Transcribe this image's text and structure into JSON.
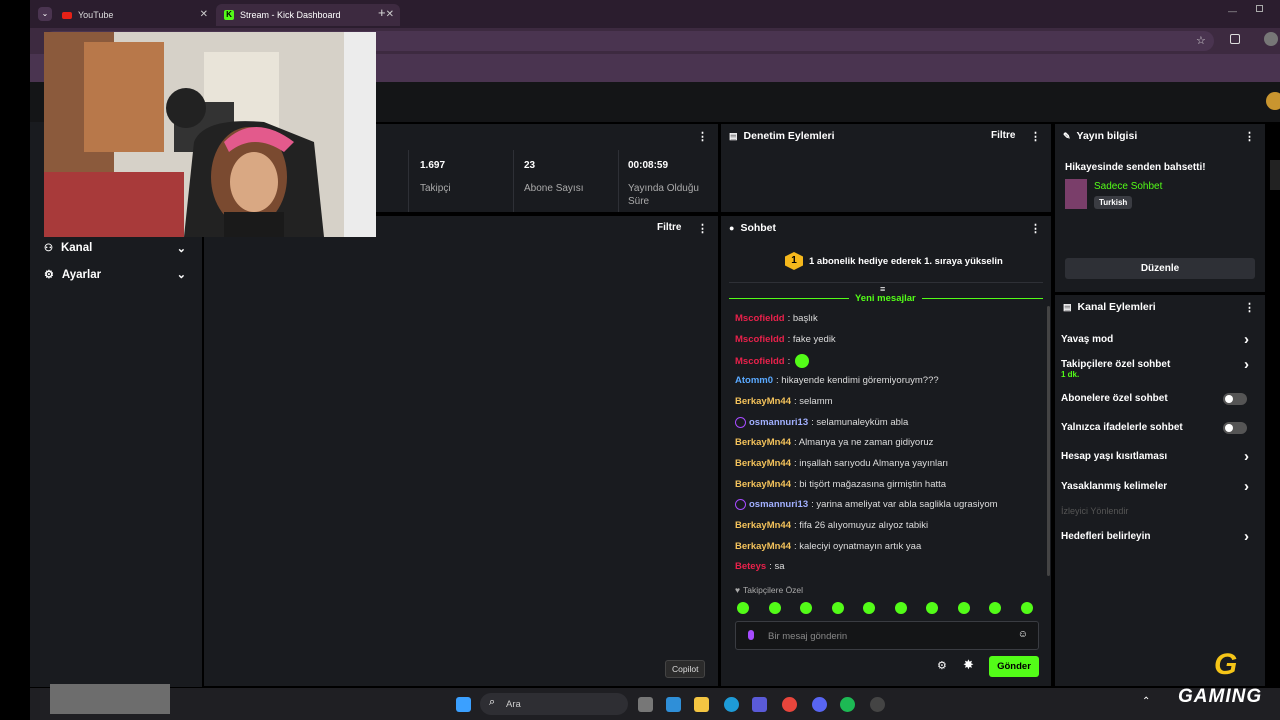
{
  "browser": {
    "tabs": [
      {
        "label": "YouTube"
      },
      {
        "label": "Stream - Kick Dashboard"
      }
    ]
  },
  "left_nav": {
    "items": [
      {
        "label": "Kanal"
      },
      {
        "label": "Ayarlar"
      }
    ]
  },
  "stats": [
    {
      "value": "1.697",
      "label": "Takipçi"
    },
    {
      "value": "23",
      "label": "Abone Sayısı"
    },
    {
      "value": "00:08:59",
      "label": "Yayında Olduğu Süre"
    }
  ],
  "activity_panel": {
    "filter_label": "Filtre"
  },
  "moderation_panel": {
    "title": "Denetim Eylemleri",
    "filter_label": "Filtre"
  },
  "stream_info": {
    "title": "Yayın bilgisi",
    "stream_title": "Hikayesinde senden bahsetti!",
    "category": "Sadece Sohbet",
    "tag": "Turkish",
    "edit_label": "Düzenle"
  },
  "chat": {
    "title": "Sohbet",
    "banner_rank": "1",
    "banner_text": "1 abonelik hediye ederek 1. sıraya yükselin",
    "new_messages_label": "Yeni mesajlar",
    "messages": [
      {
        "user": "Mscofieldd",
        "text": ": başlık",
        "color": "#e8214b",
        "badge": false,
        "emote": false
      },
      {
        "user": "Mscofieldd",
        "text": ": fake yedik",
        "color": "#e8214b",
        "badge": false,
        "emote": false
      },
      {
        "user": "Mscofieldd",
        "text": ":",
        "color": "#e8214b",
        "badge": false,
        "emote": true
      },
      {
        "user": "Atomm0",
        "text": ": hikayende kendimi göremiyoruym???",
        "color": "#5aa9ff",
        "badge": false,
        "emote": false
      },
      {
        "user": "BerkayMn44",
        "text": ": selamm",
        "color": "#f3c25b",
        "badge": false,
        "emote": false
      },
      {
        "user": "osmannuri13",
        "text": ": selamunaleyküm abla",
        "color": "#a2b0ff",
        "badge": true,
        "emote": false
      },
      {
        "user": "BerkayMn44",
        "text": ": Almanya ya ne zaman gidiyoruz",
        "color": "#f3c25b",
        "badge": false,
        "emote": false
      },
      {
        "user": "BerkayMn44",
        "text": ": inşallah sarıyodu Almanya yayınları",
        "color": "#f3c25b",
        "badge": false,
        "emote": false
      },
      {
        "user": "BerkayMn44",
        "text": ": bi tişört mağazasına girmiştin hatta",
        "color": "#f3c25b",
        "badge": false,
        "emote": false
      },
      {
        "user": "osmannuri13",
        "text": ": yarina ameliyat var abla saglikla ugrasiyom",
        "color": "#a2b0ff",
        "badge": true,
        "emote": false
      },
      {
        "user": "BerkayMn44",
        "text": ": fifa 26 alıyomuyuz alıyoz tabiki",
        "color": "#f3c25b",
        "badge": false,
        "emote": false
      },
      {
        "user": "BerkayMn44",
        "text": ": kaleciyi oynatmayın artık yaa",
        "color": "#f3c25b",
        "badge": false,
        "emote": false
      },
      {
        "user": "Beteys",
        "text": ": sa",
        "color": "#e8214b",
        "badge": false,
        "emote": false
      }
    ],
    "followers_only_label": "Takipçilere Özel",
    "input_placeholder": "Bir mesaj gönderin",
    "send_label": "Gönder"
  },
  "channel_actions": {
    "title": "Kanal Eylemleri",
    "items": [
      {
        "label": "Yavaş mod",
        "sub": "",
        "control": "chevron"
      },
      {
        "label": "Takipçilere özel sohbet",
        "sub": "1 dk.",
        "control": "chevron"
      },
      {
        "label": "Abonelere özel sohbet",
        "sub": "",
        "control": "toggle"
      },
      {
        "label": "Yalnızca ifadelerle sohbet",
        "sub": "",
        "control": "toggle"
      },
      {
        "label": "Hesap yaşı kısıtlaması",
        "sub": "",
        "control": "chevron"
      },
      {
        "label": "Yasaklanmış kelimeler",
        "sub": "",
        "control": "chevron"
      },
      {
        "label": "İzleyici Yönlendir",
        "sub": "",
        "control": "none",
        "disabled": true
      },
      {
        "label": "Hedefleri belirleyin",
        "sub": "",
        "control": "chevron"
      }
    ]
  },
  "tooltip": {
    "label": "Copilot"
  },
  "taskbar": {
    "search_label": "Ara"
  },
  "watermark": {
    "text": "GAMING"
  },
  "colors": {
    "kick_green": "#53fc18",
    "panel_bg": "#191b1f",
    "page_bg": "#000000"
  }
}
